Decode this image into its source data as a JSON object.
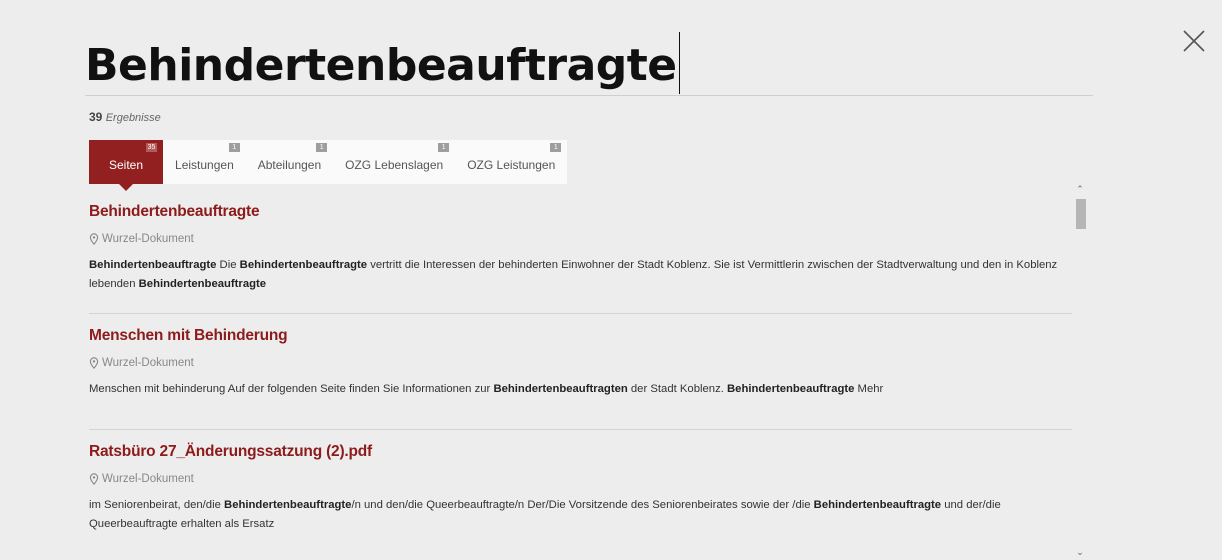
{
  "search": {
    "query": "Behindertenbeauftragte"
  },
  "result_count": {
    "number": "39",
    "label": "Ergebnisse"
  },
  "tabs": [
    {
      "label": "Seiten",
      "badge": "35",
      "active": true
    },
    {
      "label": "Leistungen",
      "badge": "1"
    },
    {
      "label": "Abteilungen",
      "badge": "1"
    },
    {
      "label": "OZG Lebenslagen",
      "badge": "1"
    },
    {
      "label": "OZG Leistungen",
      "badge": "1"
    }
  ],
  "results": [
    {
      "title": "Behindertenbeauftragte",
      "location": "Wurzel-Dokument",
      "snippet": [
        {
          "t": "Behindertenbeauftragte",
          "b": true
        },
        {
          "t": " Die "
        },
        {
          "t": "Behindertenbeauftragte",
          "b": true
        },
        {
          "t": " vertritt die Interessen der behinderten Einwohner der Stadt Koblenz. Sie ist Vermittlerin zwischen der Stadtverwaltung und den in Koblenz lebenden "
        },
        {
          "t": "Behindertenbeauftragte",
          "b": true
        }
      ]
    },
    {
      "title": "Menschen mit Behinderung",
      "location": "Wurzel-Dokument",
      "snippet": [
        {
          "t": "Menschen mit behinderung Auf der folgenden Seite finden Sie Informationen zur "
        },
        {
          "t": "Behindertenbeauftragten",
          "b": true
        },
        {
          "t": " der Stadt Koblenz. "
        },
        {
          "t": "Behindertenbeauftragte",
          "b": true
        },
        {
          "t": " Mehr"
        }
      ]
    },
    {
      "title": "Ratsbüro 27_Änderungssatzung (2).pdf",
      "location": "Wurzel-Dokument",
      "snippet": [
        {
          "t": "im Seniorenbeirat, den/die "
        },
        {
          "t": "Behindertenbeauftragte",
          "b": true
        },
        {
          "t": "/n und den/die Queerbeauftragte/n Der/Die Vorsitzende des Seniorenbeirates sowie der /die "
        },
        {
          "t": "Behindertenbeauftragte",
          "b": true
        },
        {
          "t": " und der/die Queerbeauftragte erhalten als Ersatz"
        }
      ]
    }
  ],
  "icons": {
    "close": "close-icon",
    "location": "map-pin-icon",
    "scroll_up": "chevron-up-icon",
    "scroll_down": "chevron-down-icon"
  },
  "colors": {
    "accent": "#932020",
    "title": "#8e1b1b",
    "background": "#ededed"
  }
}
